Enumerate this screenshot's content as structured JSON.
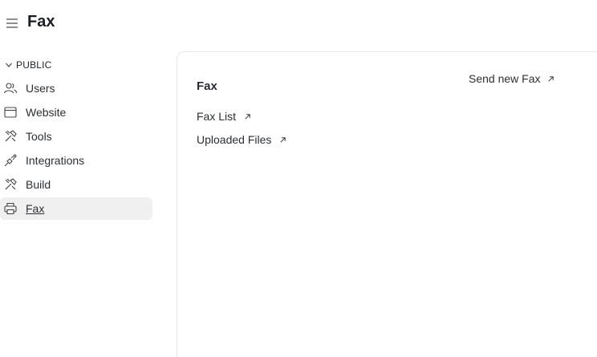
{
  "header": {
    "title": "Fax",
    "menu_icon": "hamburger-menu-icon"
  },
  "sidebar": {
    "section": {
      "label": "PUBLIC",
      "icon": "chevron-down-icon"
    },
    "items": [
      {
        "label": "Users",
        "icon": "users-icon",
        "active": false
      },
      {
        "label": "Website",
        "icon": "browser-window-icon",
        "active": false
      },
      {
        "label": "Tools",
        "icon": "tools-icon",
        "active": false
      },
      {
        "label": "Integrations",
        "icon": "plug-icon",
        "active": false
      },
      {
        "label": "Build",
        "icon": "tools-icon",
        "active": false
      },
      {
        "label": "Fax",
        "icon": "printer-icon",
        "active": true
      }
    ]
  },
  "main": {
    "title": "Fax",
    "links": [
      {
        "label": "Fax List",
        "icon": "external-arrow-icon"
      },
      {
        "label": "Uploaded Files",
        "icon": "external-arrow-icon"
      }
    ],
    "action": {
      "label": "Send new Fax",
      "icon": "external-arrow-icon"
    }
  }
}
